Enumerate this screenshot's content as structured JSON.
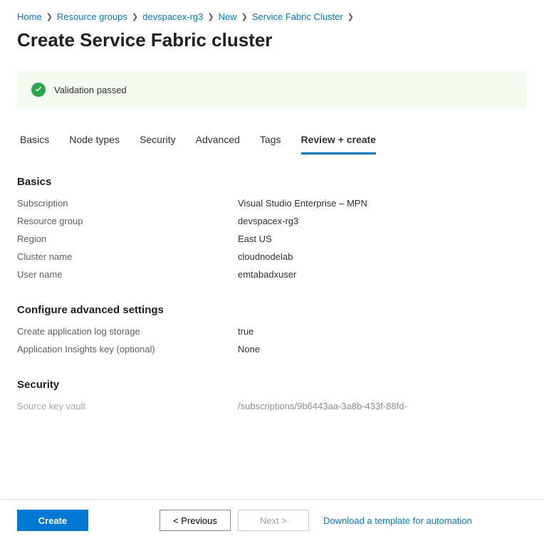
{
  "breadcrumb": [
    {
      "label": "Home"
    },
    {
      "label": "Resource groups"
    },
    {
      "label": "devspacex-rg3"
    },
    {
      "label": "New"
    },
    {
      "label": "Service Fabric Cluster"
    }
  ],
  "page_title": "Create Service Fabric cluster",
  "validation": {
    "message": "Validation passed"
  },
  "tabs": [
    {
      "label": "Basics",
      "active": false
    },
    {
      "label": "Node types",
      "active": false
    },
    {
      "label": "Security",
      "active": false
    },
    {
      "label": "Advanced",
      "active": false
    },
    {
      "label": "Tags",
      "active": false
    },
    {
      "label": "Review + create",
      "active": true
    }
  ],
  "sections": {
    "basics": {
      "title": "Basics",
      "rows": [
        {
          "key": "Subscription",
          "val": "Visual Studio Enterprise – MPN"
        },
        {
          "key": "Resource group",
          "val": "devspacex-rg3"
        },
        {
          "key": "Region",
          "val": "East US"
        },
        {
          "key": "Cluster name",
          "val": "cloudnodelab"
        },
        {
          "key": "User name",
          "val": "emtabadxuser"
        }
      ]
    },
    "advanced": {
      "title": "Configure advanced settings",
      "rows": [
        {
          "key": "Create application log storage",
          "val": "true"
        },
        {
          "key": "Application Insights key (optional)",
          "val": "None"
        }
      ]
    },
    "security": {
      "title": "Security",
      "rows": [
        {
          "key": "Source key vault",
          "val": "/subscriptions/9b6443aa-3a8b-433f-88fd-"
        }
      ]
    }
  },
  "footer": {
    "create": "Create",
    "previous": "< Previous",
    "next": "Next >",
    "download_link": "Download a template for automation"
  }
}
